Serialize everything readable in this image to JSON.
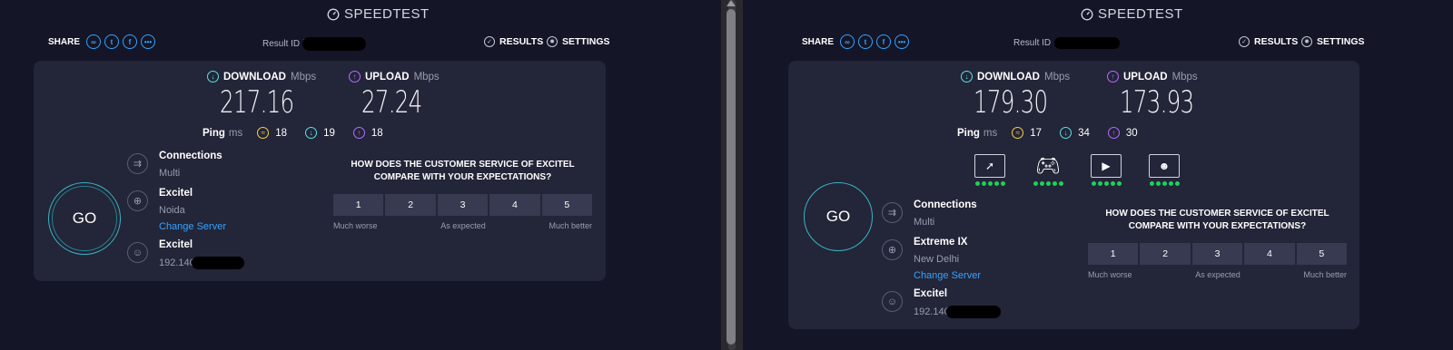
{
  "colors": {
    "background": "#141526",
    "card": "#232538",
    "download": "#5ce1e6",
    "upload": "#b76bff",
    "jitter": "#f7cd46",
    "link": "#35a3ff",
    "good": "#1fd05a"
  },
  "left": {
    "logo": "SPEEDTEST",
    "share_label": "SHARE",
    "share_icons": [
      "link-icon",
      "twitter-icon",
      "facebook-icon",
      "more-icon"
    ],
    "result_id_label": "Result ID",
    "result_id_partial": "\\",
    "results_label": "RESULTS",
    "settings_label": "SETTINGS",
    "download": {
      "label": "DOWNLOAD",
      "unit": "Mbps",
      "value": "217.16"
    },
    "upload": {
      "label": "UPLOAD",
      "unit": "Mbps",
      "value": "27.24"
    },
    "ping": {
      "label": "Ping",
      "unit": "ms",
      "idle": "18",
      "down": "19",
      "up": "18"
    },
    "go_label": "GO",
    "connections": {
      "title": "Connections",
      "value": "Multi"
    },
    "server": {
      "title": "Excitel",
      "location": "Noida",
      "change": "Change Server"
    },
    "isp": {
      "title": "Excitel",
      "ip": "192.140"
    },
    "survey": {
      "question": "HOW DOES THE CUSTOMER SERVICE OF EXCITEL COMPARE WITH YOUR EXPECTATIONS?",
      "options": [
        "1",
        "2",
        "3",
        "4",
        "5"
      ],
      "low": "Much worse",
      "mid": "As expected",
      "high": "Much better"
    }
  },
  "right": {
    "logo": "SPEEDTEST",
    "share_label": "SHARE",
    "share_icons": [
      "link-icon",
      "twitter-icon",
      "facebook-icon",
      "more-icon"
    ],
    "result_id_label": "Result ID",
    "results_label": "RESULTS",
    "settings_label": "SETTINGS",
    "download": {
      "label": "DOWNLOAD",
      "unit": "Mbps",
      "value": "179.30"
    },
    "upload": {
      "label": "UPLOAD",
      "unit": "Mbps",
      "value": "173.93"
    },
    "ping": {
      "label": "Ping",
      "unit": "ms",
      "idle": "17",
      "down": "34",
      "up": "30"
    },
    "use_cases": [
      {
        "icon": "web-browsing-icon",
        "rating": 5
      },
      {
        "icon": "gaming-icon",
        "rating": 5
      },
      {
        "icon": "video-streaming-icon",
        "rating": 5
      },
      {
        "icon": "video-chat-icon",
        "rating": 5
      }
    ],
    "go_label": "GO",
    "connections": {
      "title": "Connections",
      "value": "Multi"
    },
    "server": {
      "title": "Extreme IX",
      "location": "New Delhi",
      "change": "Change Server"
    },
    "isp": {
      "title": "Excitel",
      "ip": "192.140"
    },
    "survey": {
      "question": "HOW DOES THE CUSTOMER SERVICE OF EXCITEL COMPARE WITH YOUR EXPECTATIONS?",
      "options": [
        "1",
        "2",
        "3",
        "4",
        "5"
      ],
      "low": "Much worse",
      "mid": "As expected",
      "high": "Much better"
    }
  }
}
